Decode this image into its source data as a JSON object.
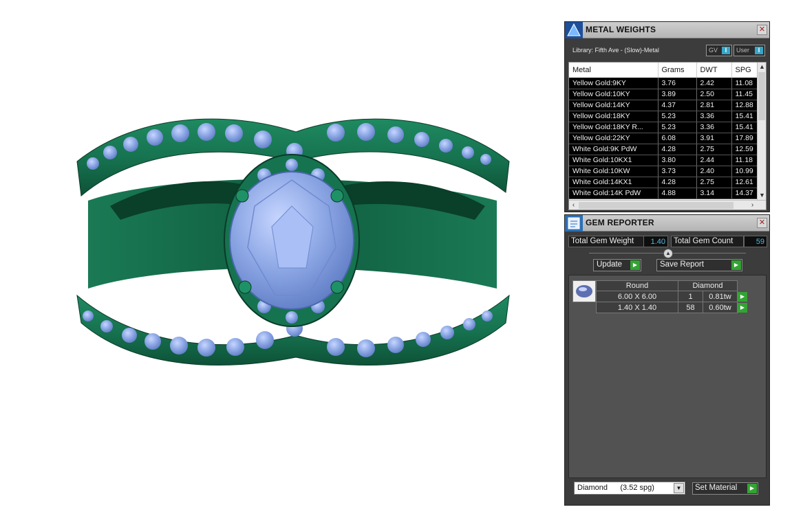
{
  "colors": {
    "metal": "#1b7a55",
    "metal_dark": "#0d4a33",
    "gem": "#8fa9e6",
    "gem_light": "#bcd0ff",
    "panel": "#3c3c3c",
    "value_text": "#58b8e0",
    "go_button": "#33a433"
  },
  "metal_panel": {
    "title": "METAL WEIGHTS",
    "close_icon": "close-icon",
    "library": "Library: Fifth Ave - (Slow)-Metal",
    "gv_label": "GV",
    "user_label": "User",
    "columns": [
      "Metal",
      "Grams",
      "DWT",
      "SPG"
    ],
    "rows": [
      [
        "Yellow Gold:9KY",
        "3.76",
        "2.42",
        "11.08"
      ],
      [
        "Yellow Gold:10KY",
        "3.89",
        "2.50",
        "11.45"
      ],
      [
        "Yellow Gold:14KY",
        "4.37",
        "2.81",
        "12.88"
      ],
      [
        "Yellow Gold:18KY",
        "5.23",
        "3.36",
        "15.41"
      ],
      [
        "Yellow Gold:18KY R...",
        "5.23",
        "3.36",
        "15.41"
      ],
      [
        "Yellow Gold:22KY",
        "6.08",
        "3.91",
        "17.89"
      ],
      [
        "White Gold:9K PdW",
        "4.28",
        "2.75",
        "12.59"
      ],
      [
        "White Gold:10KX1",
        "3.80",
        "2.44",
        "11.18"
      ],
      [
        "White Gold:10KW",
        "3.73",
        "2.40",
        "10.99"
      ],
      [
        "White Gold:14KX1",
        "4.28",
        "2.75",
        "12.61"
      ],
      [
        "White Gold:14K PdW",
        "4.88",
        "3.14",
        "14.37"
      ]
    ]
  },
  "gem_panel": {
    "title": "GEM REPORTER",
    "close_icon": "close-icon",
    "total_weight_label": "Total Gem Weight",
    "total_weight": "1.40",
    "total_count_label": "Total Gem Count",
    "total_count": "59",
    "update_label": "Update",
    "save_label": "Save Report",
    "shape_header": "Round",
    "material_header": "Diamond",
    "gems": [
      {
        "size": "6.00 X 6.00",
        "count": "1",
        "weight": "0.81tw"
      },
      {
        "size": "1.40 X 1.40",
        "count": "58",
        "weight": "0.60tw"
      }
    ],
    "material_select": "Diamond      (3.52 spg)",
    "set_material_label": "Set Material"
  }
}
